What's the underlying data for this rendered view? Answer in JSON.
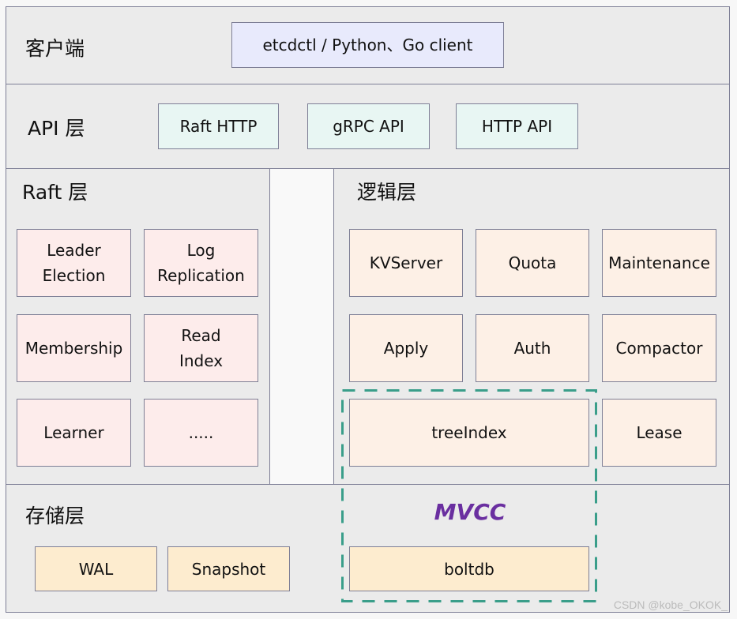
{
  "layers": {
    "client": {
      "label": "客户端",
      "items": [
        "etcdctl / Python、Go client"
      ]
    },
    "api": {
      "label": "API 层",
      "items": [
        "Raft HTTP",
        "gRPC API",
        "HTTP API"
      ]
    },
    "raft": {
      "label": "Raft 层",
      "items": [
        "Leader\nElection",
        "Log\nReplication",
        "Membership",
        "Read\nIndex",
        "Learner",
        "....."
      ]
    },
    "logic": {
      "label": "逻辑层",
      "items": [
        "KVServer",
        "Quota",
        "Maintenance",
        "Apply",
        "Auth",
        "Compactor",
        "treeIndex",
        "Lease"
      ]
    },
    "storage": {
      "label": "存储层",
      "items": [
        "WAL",
        "Snapshot",
        "boltdb"
      ]
    }
  },
  "mvcc": {
    "label": "MVCC",
    "color": "#6a2fa0",
    "border_color": "#3a9e8a"
  },
  "watermark": "CSDN @kobe_OKOK_",
  "colors": {
    "client": "#e8eafc",
    "api": "#e8f6f3",
    "raft": "#fdeceb",
    "logic": "#fdf0e6",
    "storage": "#fdeccf",
    "layer": "#ebebeb"
  }
}
